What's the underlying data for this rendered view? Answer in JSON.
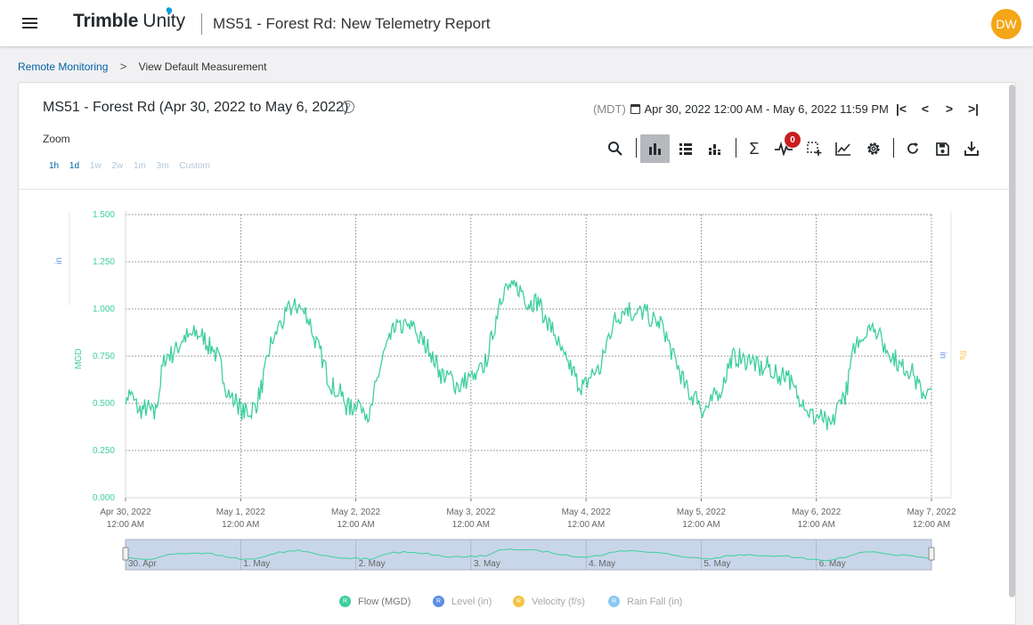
{
  "header": {
    "logo_bold": "Trimble",
    "logo_light": "Unity",
    "title": "MS51 - Forest Rd: New Telemetry Report",
    "avatar_initials": "DW",
    "avatar_color": "#f4a616"
  },
  "breadcrumb": {
    "link": "Remote Monitoring",
    "separator": ">",
    "current": "View Default Measurement"
  },
  "report": {
    "title": "MS51 - Forest Rd (Apr 30, 2022 to May 6, 2022)",
    "help_icon": "help-circle-icon",
    "timezone": "(MDT)",
    "date_range": "Apr 30, 2022 12:00 AM - May 6, 2022 11:59 PM",
    "nav": {
      "first": "|<",
      "prev": "<",
      "next": ">",
      "last": ">|"
    }
  },
  "zoom": {
    "label": "Zoom",
    "options": [
      "1h",
      "1d",
      "1w",
      "2w",
      "1m",
      "3m",
      "Custom"
    ],
    "enabled": [
      "1h",
      "1d"
    ]
  },
  "toolbar": {
    "icons": [
      "search-icon",
      "bar-chart-icon",
      "list-view-icon",
      "stacked-bars-icon",
      "sigma-icon",
      "pulse-icon",
      "select-region-icon",
      "line-chart-icon",
      "gear-icon",
      "refresh-icon",
      "save-icon",
      "download-icon"
    ],
    "active": "bar-chart-icon",
    "alert_count": "0"
  },
  "chart_data": {
    "type": "line",
    "title": "",
    "y_left_label": "MGD",
    "y_left_level_label": "in",
    "y_right_labels": [
      "in",
      "f/s"
    ],
    "ylim": [
      0,
      1.5
    ],
    "y_ticks": [
      "0.000",
      "0.250",
      "0.500",
      "0.750",
      "1.000",
      "1.250",
      "1.500"
    ],
    "x_ticks": [
      {
        "date": "Apr 30, 2022",
        "time": "12:00 AM"
      },
      {
        "date": "May 1, 2022",
        "time": "12:00 AM"
      },
      {
        "date": "May 2, 2022",
        "time": "12:00 AM"
      },
      {
        "date": "May 3, 2022",
        "time": "12:00 AM"
      },
      {
        "date": "May 4, 2022",
        "time": "12:00 AM"
      },
      {
        "date": "May 5, 2022",
        "time": "12:00 AM"
      },
      {
        "date": "May 6, 2022",
        "time": "12:00 AM"
      },
      {
        "date": "May 7, 2022",
        "time": "12:00 AM"
      }
    ],
    "navigator_labels": [
      "30. Apr",
      "1. May",
      "2. May",
      "3. May",
      "4. May",
      "5. May",
      "6. May"
    ],
    "series": [
      {
        "name": "Flow (MGD)",
        "color": "#3ecf9c",
        "x_hours": [
          0,
          3,
          6,
          8,
          10,
          12,
          14,
          16,
          18,
          20,
          22,
          24,
          27,
          30,
          32,
          34,
          36,
          38,
          40,
          42,
          44,
          46,
          48,
          51,
          54,
          56,
          58,
          60,
          62,
          64,
          66,
          68,
          70,
          72,
          75,
          78,
          80,
          82,
          84,
          86,
          88,
          90,
          92,
          94,
          96,
          99,
          102,
          104,
          106,
          108,
          110,
          112,
          114,
          116,
          118,
          120,
          123,
          126,
          128,
          130,
          132,
          134,
          136,
          138,
          140,
          142,
          144,
          147,
          150,
          152,
          154,
          156,
          158,
          160,
          162,
          164,
          166,
          168
        ],
        "values": [
          0.55,
          0.48,
          0.44,
          0.72,
          0.78,
          0.83,
          0.88,
          0.85,
          0.8,
          0.68,
          0.52,
          0.47,
          0.46,
          0.78,
          0.92,
          0.98,
          1.03,
          0.95,
          0.82,
          0.64,
          0.58,
          0.48,
          0.5,
          0.45,
          0.78,
          0.88,
          0.92,
          0.88,
          0.84,
          0.74,
          0.66,
          0.62,
          0.6,
          0.62,
          0.7,
          1.05,
          1.12,
          1.1,
          1.05,
          1.02,
          0.95,
          0.82,
          0.72,
          0.62,
          0.6,
          0.7,
          0.95,
          1.0,
          0.98,
          0.97,
          0.96,
          0.9,
          0.78,
          0.62,
          0.55,
          0.47,
          0.52,
          0.72,
          0.75,
          0.72,
          0.7,
          0.68,
          0.66,
          0.64,
          0.56,
          0.47,
          0.43,
          0.38,
          0.55,
          0.8,
          0.87,
          0.9,
          0.82,
          0.74,
          0.7,
          0.65,
          0.57,
          0.53
        ]
      },
      {
        "name": "Level (in)",
        "color": "#5b8ee6"
      },
      {
        "name": "Velocity (f/s)",
        "color": "#f5c242"
      },
      {
        "name": "Rain Fall (in)",
        "color": "#8cc8ef"
      }
    ]
  }
}
